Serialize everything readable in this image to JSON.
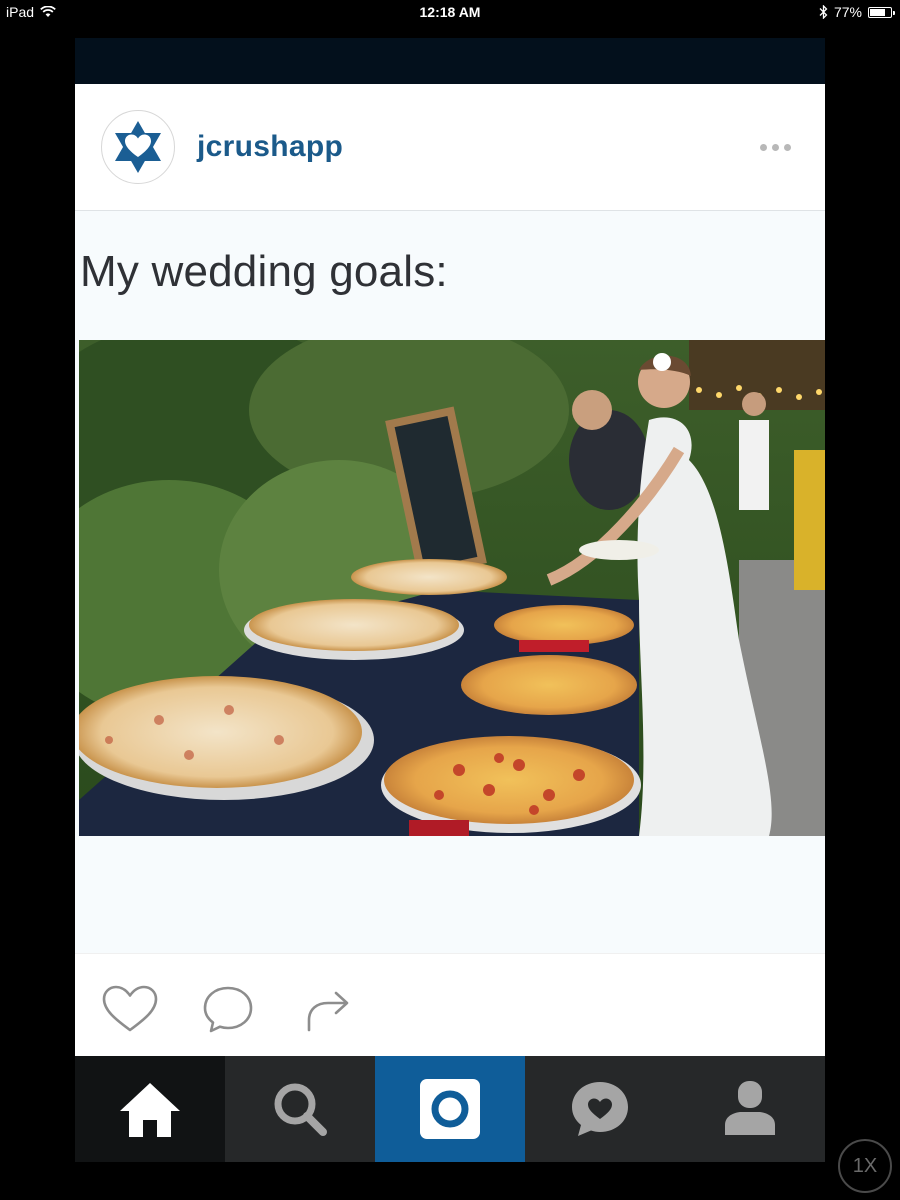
{
  "status_bar": {
    "device": "iPad",
    "time": "12:18 AM",
    "battery": "77%",
    "battery_level": 0.77
  },
  "post": {
    "username": "jcrushapp",
    "avatar_icon": "star-of-david-heart-icon",
    "caption": "My wedding goals:",
    "photo_description_icon": "wedding-pizza-buffet-photo"
  },
  "actions": {
    "like_icon": "heart-icon",
    "comment_icon": "comment-icon",
    "share_icon": "share-arrow-icon"
  },
  "tab_bar": {
    "items": [
      "home-icon",
      "search-icon",
      "camera-icon",
      "chat-heart-icon",
      "profile-icon"
    ],
    "active": "home-icon"
  },
  "zoom_button": "1X",
  "colors": {
    "brand_blue": "#1b5a8a",
    "camera_tab": "#0f5d99",
    "tab_dark": "#262829",
    "tab_home": "#111314"
  }
}
